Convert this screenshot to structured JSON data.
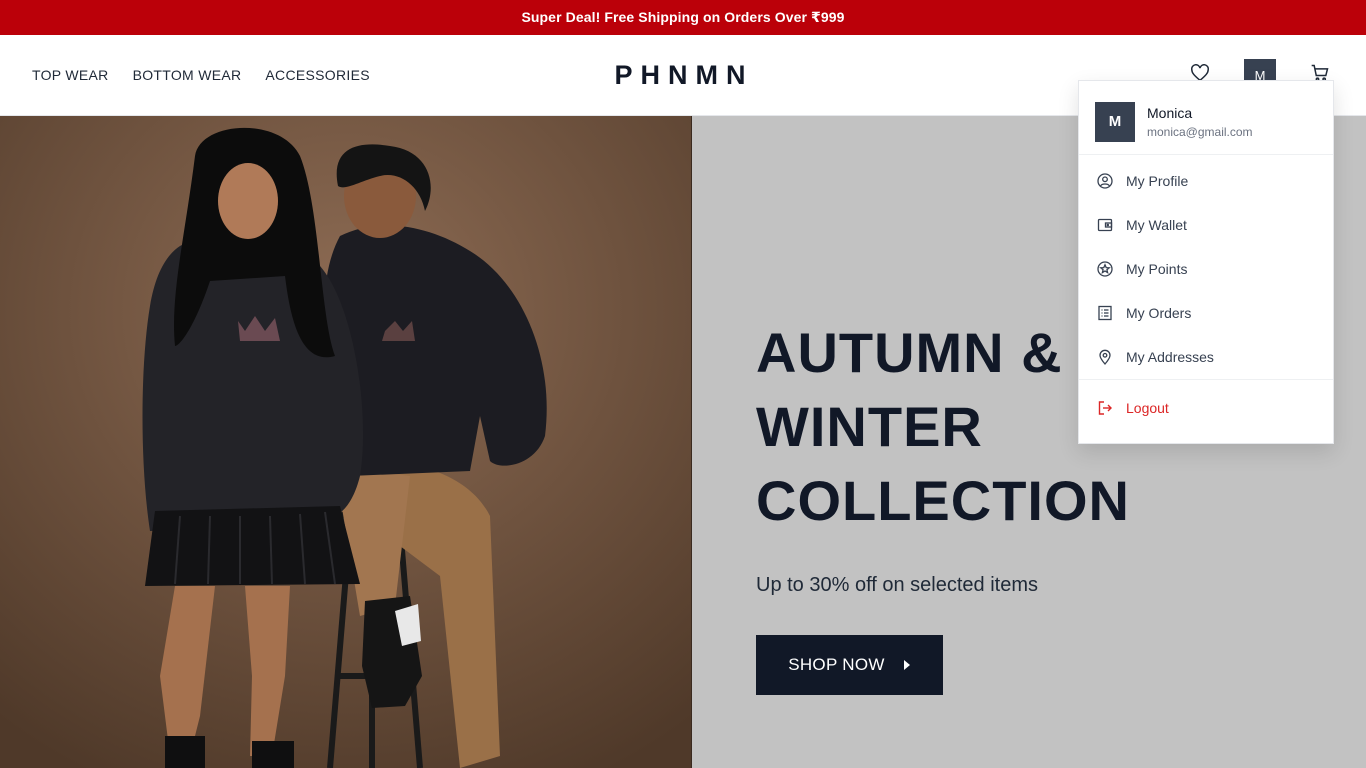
{
  "promo": {
    "text": "Super Deal! Free Shipping on Orders Over ₹999"
  },
  "header": {
    "nav": [
      {
        "label": "TOP WEAR"
      },
      {
        "label": "BOTTOM WEAR"
      },
      {
        "label": "ACCESSORIES"
      }
    ],
    "logo": "PHNMN",
    "avatar_initial": "M",
    "icons": [
      "heart-icon",
      "user-avatar",
      "cart-icon"
    ]
  },
  "hero": {
    "title_lines": [
      "AUTUMN &",
      "WINTER",
      "COLLECTION"
    ],
    "subtitle": "Up to 30% off on selected items",
    "cta_label": "SHOP NOW",
    "cta_icon": "caret-right-icon"
  },
  "account_menu": {
    "user": {
      "initial": "M",
      "name": "Monica",
      "email": "monica@gmail.com"
    },
    "items": [
      {
        "label": "My Profile",
        "icon": "user-circle-icon"
      },
      {
        "label": "My Wallet",
        "icon": "wallet-icon"
      },
      {
        "label": "My Points",
        "icon": "star-badge-icon"
      },
      {
        "label": "My Orders",
        "icon": "list-icon"
      },
      {
        "label": "My Addresses",
        "icon": "map-pin-icon"
      }
    ],
    "logout": {
      "label": "Logout",
      "icon": "logout-icon"
    }
  },
  "colors": {
    "promo_bg": "#bb0009",
    "primary_dark": "#111827",
    "avatar_bg": "#374151",
    "hero_bg": "#c2c2c2",
    "logout_red": "#dc2626"
  }
}
